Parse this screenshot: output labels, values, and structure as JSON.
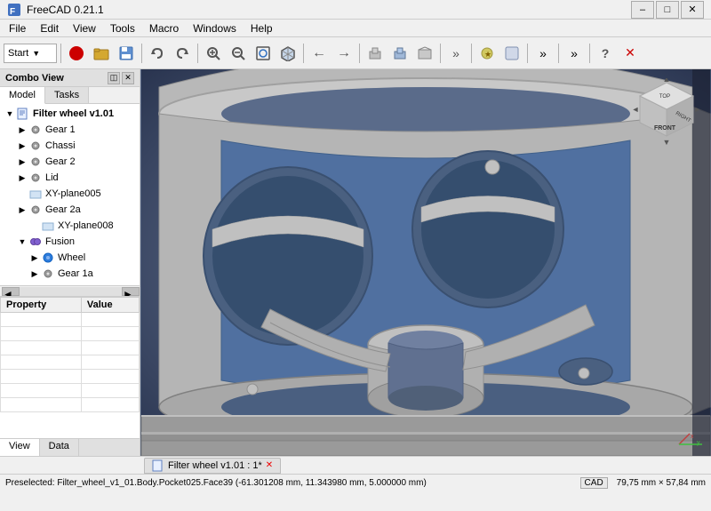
{
  "titlebar": {
    "title": "FreeCAD 0.21.1",
    "minimize": "–",
    "maximize": "□",
    "close": "✕"
  },
  "menubar": {
    "items": [
      "File",
      "Edit",
      "View",
      "Tools",
      "Macro",
      "Windows",
      "Help"
    ]
  },
  "toolbar": {
    "start_label": "Start",
    "dropdown_arrow": "▼"
  },
  "left_panel": {
    "title": "Combo View",
    "tabs": [
      "Model",
      "Tasks"
    ],
    "active_tab": "Model",
    "tree": {
      "root": {
        "label": "Filter wheel v1.01",
        "expanded": true,
        "children": [
          {
            "label": "Gear 1",
            "indent": 1,
            "icon": "gear"
          },
          {
            "label": "Chassi",
            "indent": 1,
            "icon": "gear"
          },
          {
            "label": "Gear 2",
            "indent": 1,
            "icon": "gear"
          },
          {
            "label": "Lid",
            "indent": 1,
            "icon": "gear"
          },
          {
            "label": "XY-plane005",
            "indent": 1,
            "icon": "plane"
          },
          {
            "label": "Gear 2a",
            "indent": 1,
            "icon": "gear",
            "has_toggle": true
          },
          {
            "label": "XY-plane008",
            "indent": 2,
            "icon": "plane"
          },
          {
            "label": "Fusion",
            "indent": 1,
            "icon": "fusion",
            "has_toggle": true,
            "expanded": true
          },
          {
            "label": "Wheel",
            "indent": 2,
            "icon": "wheel",
            "has_toggle": true
          },
          {
            "label": "Gear 1a",
            "indent": 2,
            "icon": "gear",
            "has_toggle": true
          }
        ]
      }
    }
  },
  "properties": {
    "col_property": "Property",
    "col_value": "Value",
    "rows": []
  },
  "bottom_tabs": [
    "View",
    "Data"
  ],
  "doc_tab": {
    "label": "Filter wheel v1.01 : 1*"
  },
  "statusbar": {
    "message": "Preselected: Filter_wheel_v1_01.Body.Pocket025.Face39 (-61.301208 mm, 11.343980 mm, 5.000000 mm)",
    "cad": "CAD",
    "coordinates": "79,75 mm × 57,84 mm"
  }
}
